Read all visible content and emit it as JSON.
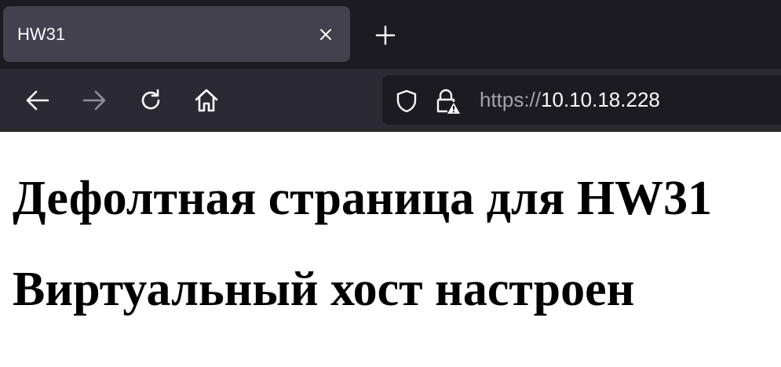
{
  "browser": {
    "tab": {
      "title": "HW31",
      "close_icon": "close-icon"
    },
    "new_tab_icon": "plus-icon",
    "toolbar": {
      "back_icon": "back-arrow-icon",
      "forward_icon": "forward-arrow-icon",
      "reload_icon": "reload-icon",
      "home_icon": "home-icon"
    },
    "urlbar": {
      "tracking_protection_icon": "shield-icon",
      "security_icon": "lock-warning-icon",
      "scheme": "https://",
      "host": "10.10.18.228"
    }
  },
  "page": {
    "heading_1": "Дефолтная страница для HW31",
    "heading_2": "Виртуальный хост настроен"
  },
  "colors": {
    "tabstrip_bg": "#1c1b22",
    "active_tab_bg": "#42414d",
    "toolbar_bg": "#2b2a33",
    "urlbar_bg": "#1c1b22",
    "toolbar_text": "#fbfbfe",
    "disabled_icon": "#8f8f9d",
    "url_scheme": "#a4a3ab",
    "page_bg": "#ffffff",
    "heading_text": "#000000"
  }
}
